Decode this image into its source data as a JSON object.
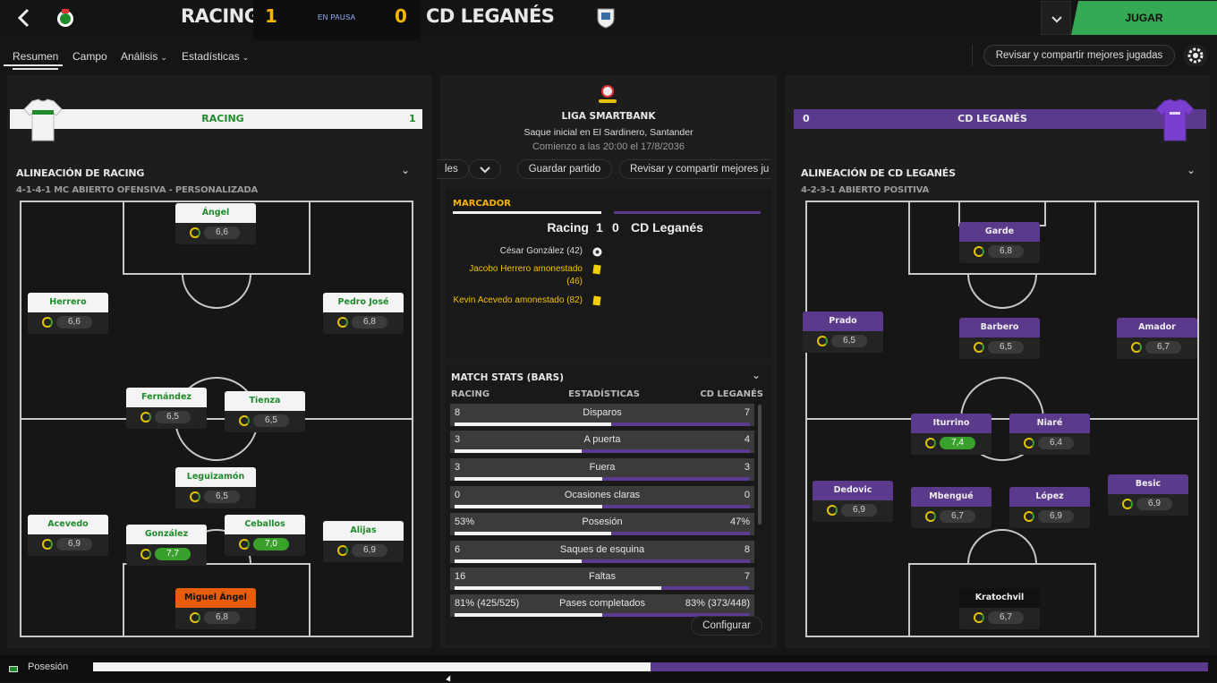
{
  "header": {
    "home_name": "RACING",
    "home_score": "1",
    "status": "EN PAUSA",
    "away_score": "0",
    "away_name": "CD LEGANÉS",
    "play_button": "JUGAR"
  },
  "nav": {
    "tabs": [
      {
        "label": "Resumen",
        "active": true
      },
      {
        "label": "Campo",
        "active": false
      },
      {
        "label": "Análisis",
        "active": false
      },
      {
        "label": "Estadísticas",
        "active": false
      }
    ],
    "review_button": "Revisar y compartir mejores jugadas"
  },
  "home": {
    "bar_name": "RACING",
    "bar_score": "1",
    "lineup_title": "ALINEACIÓN DE RACING",
    "formation": "4-1-4-1 MC ABIERTO OFENSIVA - PERSONALIZADA",
    "players": [
      {
        "name": "Ángel",
        "rating": "6,6",
        "good": false
      },
      {
        "name": "Herrero",
        "rating": "6,6",
        "good": false
      },
      {
        "name": "Pedro José",
        "rating": "6,8",
        "good": false
      },
      {
        "name": "Fernández",
        "rating": "6,5",
        "good": false
      },
      {
        "name": "Tienza",
        "rating": "6,5",
        "good": false
      },
      {
        "name": "Leguizamón",
        "rating": "6,5",
        "good": false
      },
      {
        "name": "Acevedo",
        "rating": "6,9",
        "good": false
      },
      {
        "name": "González",
        "rating": "7,7",
        "good": true
      },
      {
        "name": "Ceballos",
        "rating": "7,0",
        "good": true
      },
      {
        "name": "Alijas",
        "rating": "6,9",
        "good": false
      },
      {
        "name": "Miguel Ángel",
        "rating": "6,8",
        "good": false
      }
    ]
  },
  "away": {
    "bar_name": "CD LEGANÉS",
    "bar_score": "0",
    "lineup_title": "ALINEACIÓN DE CD LEGANÉS",
    "formation": "4-2-3-1 ABIERTO POSITIVA",
    "players": [
      {
        "name": "Garde",
        "rating": "6,8",
        "good": false
      },
      {
        "name": "Prado",
        "rating": "6,5",
        "good": false
      },
      {
        "name": "Barbero",
        "rating": "6,5",
        "good": false
      },
      {
        "name": "Amador",
        "rating": "6,7",
        "good": false
      },
      {
        "name": "Iturrino",
        "rating": "7,4",
        "good": true
      },
      {
        "name": "Niaré",
        "rating": "6,4",
        "good": false
      },
      {
        "name": "Dedovic",
        "rating": "6,9",
        "good": false
      },
      {
        "name": "Mbengué",
        "rating": "6,7",
        "good": false
      },
      {
        "name": "López",
        "rating": "6,9",
        "good": false
      },
      {
        "name": "Besic",
        "rating": "6,9",
        "good": false
      },
      {
        "name": "Kratochvil",
        "rating": "6,7",
        "good": false
      }
    ]
  },
  "match": {
    "league": "LIGA SMARTBANK",
    "venue": "Saque inicial en El Sardinero, Santander",
    "kickoff": "Comienzo a las 20:00 el 17/8/2036",
    "toolbar": {
      "partial": "les",
      "save": "Guardar partido",
      "review": "Revisar y compartir mejores ju"
    },
    "scoreboard": {
      "title": "MARCADOR",
      "home": "Racing",
      "home_score": "1",
      "away_score": "0",
      "away": "CD Leganés",
      "events": [
        {
          "text": "César González (42)",
          "type": "goal"
        },
        {
          "text": "Jacobo Herrero amonestado (46)",
          "type": "yellow"
        },
        {
          "text": "Kevin Acevedo amonestado (82)",
          "type": "yellow"
        }
      ]
    },
    "stats": {
      "title": "MATCH STATS (BARS)",
      "col_home": "RACING",
      "col_label": "ESTADÍSTICAS",
      "col_away": "CD LEGANÉS",
      "rows": [
        {
          "home": "8",
          "label": "Disparos",
          "away": "7",
          "home_frac": 0.53
        },
        {
          "home": "3",
          "label": "A puerta",
          "away": "4",
          "home_frac": 0.43
        },
        {
          "home": "3",
          "label": "Fuera",
          "away": "3",
          "home_frac": 0.5
        },
        {
          "home": "0",
          "label": "Ocasiones claras",
          "away": "0",
          "home_frac": 0.5
        },
        {
          "home": "53%",
          "label": "Posesión",
          "away": "47%",
          "home_frac": 0.53
        },
        {
          "home": "6",
          "label": "Saques de esquina",
          "away": "8",
          "home_frac": 0.43
        },
        {
          "home": "16",
          "label": "Faltas",
          "away": "7",
          "home_frac": 0.7
        },
        {
          "home": "81% (425/525)",
          "label": "Pases completados",
          "away": "83% (373/448)",
          "home_frac": 0.5
        }
      ],
      "configure": "Configurar"
    }
  },
  "bottom": {
    "label": "Posesión",
    "home_frac": 0.5
  },
  "colors": {
    "racing_green": "#1f8b2b",
    "leganes_purple": "#5b3a8c",
    "play_green": "#34a853",
    "score_gold": "#f5b400"
  }
}
